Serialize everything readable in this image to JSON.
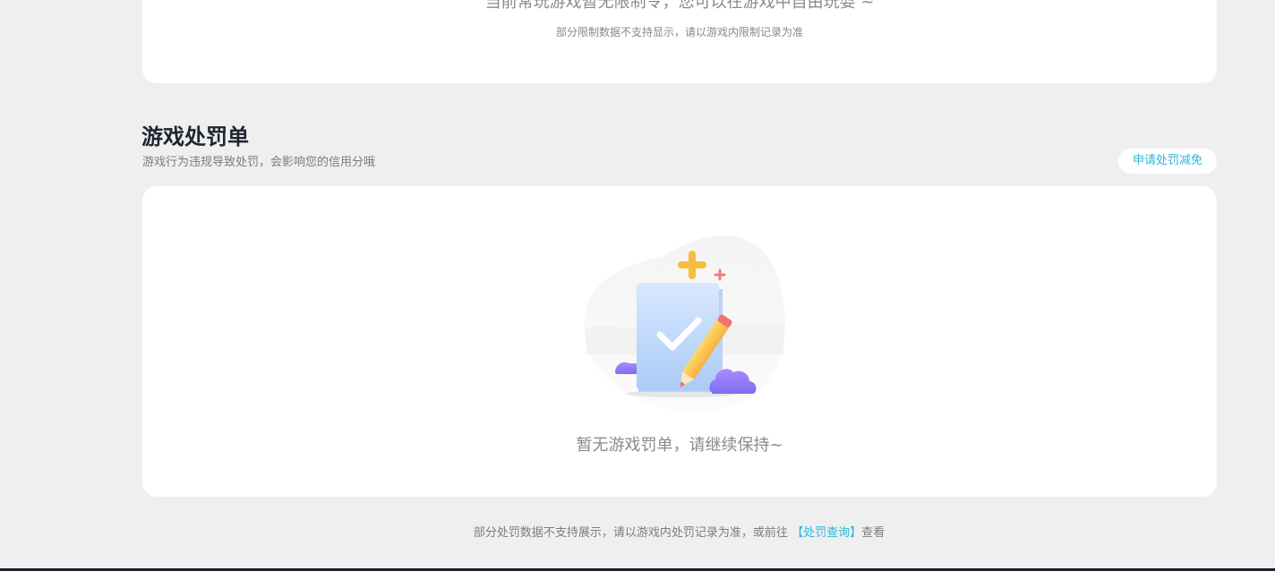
{
  "top_card": {
    "main_text": "当前常玩游戏暂无限制令，您可以在游戏中自由玩耍 ~",
    "sub_text": "部分限制数据不支持显示，请以游戏内限制记录为准"
  },
  "penalty_section": {
    "title": "游戏处罚单",
    "subtitle": "游戏行为违规导致处罚，会影响您的信用分哦",
    "appeal_button_label": "申请处罚减免",
    "empty_text": "暂无游戏罚单，请继续保持~",
    "illustration_icon": "checklist-pencil-icon"
  },
  "footer": {
    "prefix": "部分处罚数据不支持展示，请以游戏内处罚记录为准，或前往",
    "link_label": "【处罚查询】",
    "suffix": "查看"
  },
  "colors": {
    "page_bg": "#efefef",
    "card_bg": "#ffffff",
    "accent": "#2fb5d8",
    "title": "#1f2530",
    "muted_text": "#8a8a8a"
  }
}
